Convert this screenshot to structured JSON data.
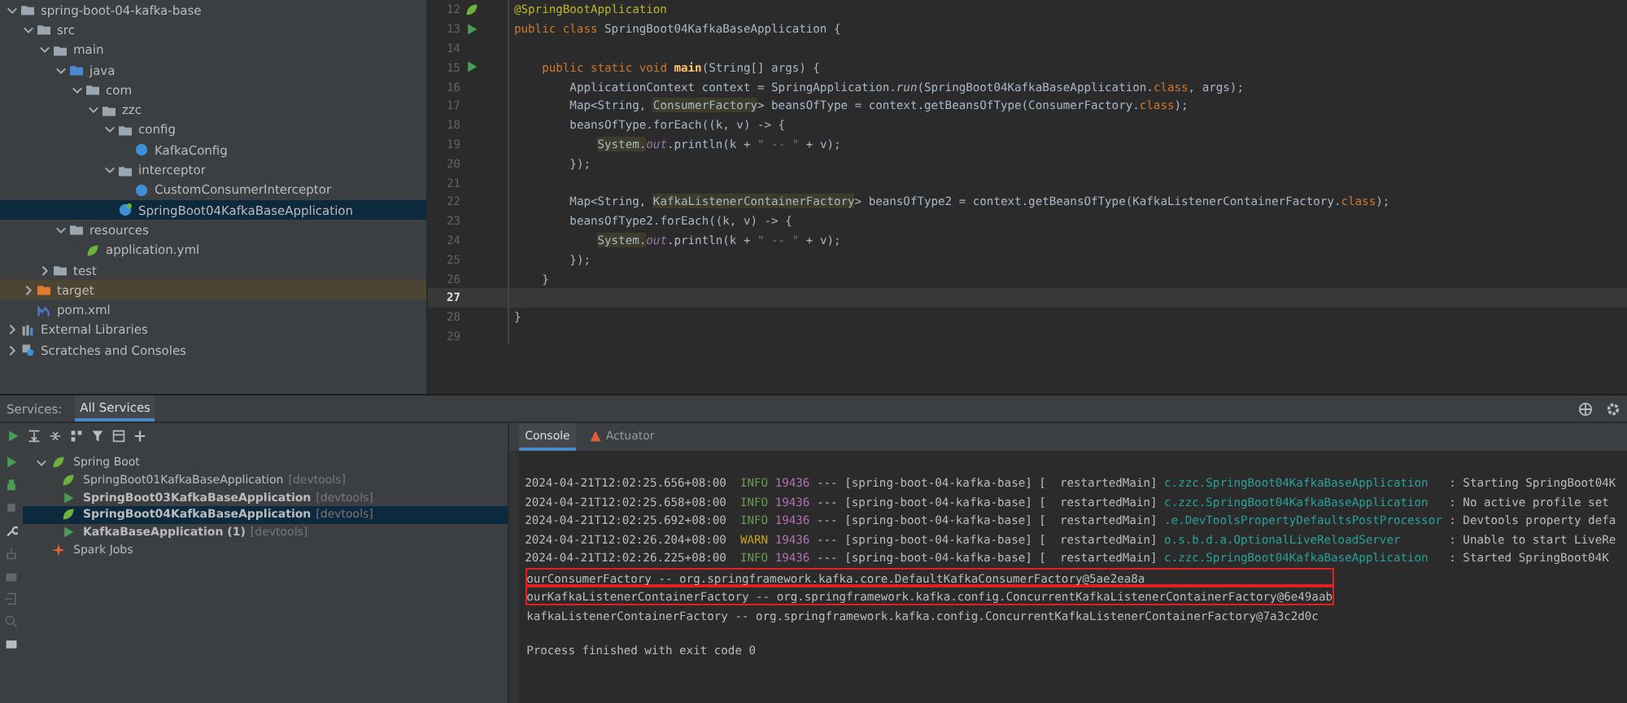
{
  "project_tree": [
    {
      "label": "spring-boot-04-kafka-base",
      "kind": "module",
      "expanded": true,
      "selected": false,
      "children": [
        {
          "label": "src",
          "kind": "folder",
          "expanded": true,
          "selected": false,
          "children": [
            {
              "label": "main",
              "kind": "folder",
              "expanded": true,
              "selected": false,
              "children": [
                {
                  "label": "java",
                  "kind": "source-folder",
                  "expanded": true,
                  "selected": false,
                  "children": [
                    {
                      "label": "com",
                      "kind": "package",
                      "expanded": true,
                      "selected": false,
                      "children": [
                        {
                          "label": "zzc",
                          "kind": "package",
                          "expanded": true,
                          "selected": false,
                          "children": [
                            {
                              "label": "config",
                              "kind": "package",
                              "expanded": true,
                              "selected": false,
                              "children": [
                                {
                                  "label": "KafkaConfig",
                                  "kind": "class",
                                  "selected": false
                                }
                              ]
                            },
                            {
                              "label": "interceptor",
                              "kind": "package",
                              "expanded": true,
                              "selected": false,
                              "children": [
                                {
                                  "label": "CustomConsumerInterceptor",
                                  "kind": "class",
                                  "selected": false
                                }
                              ]
                            },
                            {
                              "label": "SpringBoot04KafkaBaseApplication",
                              "kind": "spring-class",
                              "selected": true
                            }
                          ]
                        }
                      ]
                    }
                  ]
                },
                {
                  "label": "resources",
                  "kind": "resource-folder",
                  "expanded": true,
                  "selected": false,
                  "children": [
                    {
                      "label": "application.yml",
                      "kind": "yaml",
                      "selected": false
                    }
                  ]
                }
              ]
            },
            {
              "label": "test",
              "kind": "folder",
              "expanded": false,
              "selected": false
            }
          ]
        },
        {
          "label": "target",
          "kind": "excluded-folder",
          "expanded": false,
          "selected": false
        },
        {
          "label": "pom.xml",
          "kind": "maven",
          "selected": false
        }
      ]
    },
    {
      "label": "External Libraries",
      "kind": "library",
      "expanded": false,
      "selected": false
    },
    {
      "label": "Scratches and Consoles",
      "kind": "scratches",
      "expanded": false,
      "selected": false
    }
  ],
  "editor": {
    "lines": [
      {
        "number": "12",
        "kind": "spring",
        "current": false,
        "segments": [
          {
            "text": "@SpringBootApplication",
            "kind": "annotation"
          }
        ]
      },
      {
        "number": "13",
        "kind": "run",
        "current": false,
        "segments": [
          {
            "text": "public class ",
            "kind": "keyword"
          },
          {
            "text": "SpringBoot04KafkaBaseApplication {",
            "kind": "plain"
          }
        ]
      },
      {
        "number": "14",
        "kind": "plain",
        "current": false
      },
      {
        "number": "15",
        "kind": "run",
        "current": false,
        "segments": [
          {
            "text": "    public static void ",
            "kind": "keyword"
          },
          {
            "text": "main",
            "kind": "method"
          },
          {
            "text": "(String[] args) {",
            "kind": "plain"
          }
        ]
      },
      {
        "number": "16",
        "kind": "plain",
        "current": false,
        "segments": [
          {
            "text": "        ApplicationContext context = SpringApplication.",
            "kind": "plain"
          },
          {
            "text": "run",
            "kind": "static"
          },
          {
            "text": "(SpringBoot04KafkaBaseApplication.",
            "kind": "plain"
          },
          {
            "text": "class",
            "kind": "keyword"
          },
          {
            "text": ", args);",
            "kind": "plain"
          }
        ]
      },
      {
        "number": "17",
        "kind": "plain",
        "current": false,
        "segments": [
          {
            "text": "        Map<String, ",
            "kind": "plain"
          },
          {
            "text": "ConsumerFactory",
            "kind": "highlight"
          },
          {
            "text": "> beansOfType = context.getBeansOfType(ConsumerFactory.",
            "kind": "plain"
          },
          {
            "text": "class",
            "kind": "keyword"
          },
          {
            "text": ");",
            "kind": "plain"
          }
        ]
      },
      {
        "number": "18",
        "kind": "plain",
        "current": false,
        "segments": [
          {
            "text": "        beansOfType.forEach((k, v) -> {",
            "kind": "plain"
          }
        ]
      },
      {
        "number": "19",
        "kind": "plain",
        "current": false,
        "segments": [
          {
            "text": "            System.",
            "kind": "highlight"
          },
          {
            "text": "out",
            "kind": "field"
          },
          {
            "text": ".println(k + ",
            "kind": "plain"
          },
          {
            "text": "\" -- \"",
            "kind": "string"
          },
          {
            "text": " + v);",
            "kind": "plain"
          }
        ]
      },
      {
        "number": "20",
        "kind": "plain",
        "current": false,
        "segments": [
          {
            "text": "        });",
            "kind": "plain"
          }
        ]
      },
      {
        "number": "21",
        "kind": "plain",
        "current": false
      },
      {
        "number": "22",
        "kind": "plain",
        "current": false,
        "segments": [
          {
            "text": "        Map<String, ",
            "kind": "plain"
          },
          {
            "text": "KafkaListenerContainerFactory",
            "kind": "highlight"
          },
          {
            "text": "> beansOfType2 = context.getBeansOfType(KafkaListenerContainerFactory.",
            "kind": "plain"
          },
          {
            "text": "class",
            "kind": "keyword"
          },
          {
            "text": ");",
            "kind": "plain"
          }
        ]
      },
      {
        "number": "23",
        "kind": "plain",
        "current": false,
        "segments": [
          {
            "text": "        beansOfType2.forEach((k, v) -> {",
            "kind": "plain"
          }
        ]
      },
      {
        "number": "24",
        "kind": "plain",
        "current": false,
        "segments": [
          {
            "text": "            System.",
            "kind": "highlight"
          },
          {
            "text": "out",
            "kind": "field"
          },
          {
            "text": ".println(k + ",
            "kind": "plain"
          },
          {
            "text": "\" -- \"",
            "kind": "string"
          },
          {
            "text": " + v);",
            "kind": "plain"
          }
        ]
      },
      {
        "number": "25",
        "kind": "plain",
        "current": false,
        "segments": [
          {
            "text": "        });",
            "kind": "plain"
          }
        ]
      },
      {
        "number": "26",
        "kind": "plain",
        "current": false,
        "segments": [
          {
            "text": "    }",
            "kind": "plain"
          }
        ]
      },
      {
        "number": "27",
        "kind": "plain",
        "current": true
      },
      {
        "number": "28",
        "kind": "plain",
        "current": false,
        "segments": [
          {
            "text": "}",
            "kind": "plain"
          }
        ]
      },
      {
        "number": "29",
        "kind": "plain",
        "current": false
      }
    ]
  },
  "services": {
    "title": "Services:",
    "tabs": [
      {
        "label": "All Services",
        "selected": true
      }
    ],
    "tree": [
      {
        "label": "Spring Boot",
        "kind": "group",
        "expanded": true,
        "selected": false,
        "children": [
          {
            "label": "SpringBoot01KafkaBaseApplication",
            "tag": "[devtools]",
            "kind": "idle",
            "selected": false
          },
          {
            "label": "SpringBoot03KafkaBaseApplication",
            "tag": "[devtools]",
            "kind": "running",
            "selected": false
          },
          {
            "label": "SpringBoot04KafkaBaseApplication",
            "tag": "[devtools]",
            "kind": "finished",
            "selected": true
          },
          {
            "label": "KafkaBaseApplication (1)",
            "tag": "[devtools]",
            "kind": "running",
            "selected": false
          }
        ]
      },
      {
        "label": "Spark Jobs",
        "kind": "spark",
        "selected": false
      }
    ]
  },
  "console": {
    "tabs": [
      {
        "label": "Console",
        "selected": true
      },
      {
        "label": "Actuator",
        "selected": false
      }
    ],
    "log": [
      {
        "time": "2024-04-21T12:02:25.656+08:00",
        "level": "INFO",
        "pid": "19436",
        "thread": "--- [spring-boot-04-kafka-base] [  restartedMain]",
        "logger": "c.zzc.SpringBoot04KafkaBaseApplication   ",
        "message": ": Starting SpringBoot04K"
      },
      {
        "time": "2024-04-21T12:02:25.658+08:00",
        "level": "INFO",
        "pid": "19436",
        "thread": "--- [spring-boot-04-kafka-base] [  restartedMain]",
        "logger": "c.zzc.SpringBoot04KafkaBaseApplication   ",
        "message": ": No active profile set"
      },
      {
        "time": "2024-04-21T12:02:25.692+08:00",
        "level": "INFO",
        "pid": "19436",
        "thread": "--- [spring-boot-04-kafka-base] [  restartedMain]",
        "logger": ".e.DevToolsPropertyDefaultsPostProcessor ",
        "message": ": Devtools property defa"
      },
      {
        "time": "2024-04-21T12:02:26.204+08:00",
        "level": "WARN",
        "pid": "19436",
        "thread": "--- [spring-boot-04-kafka-base] [  restartedMain]",
        "logger": "o.s.b.d.a.OptionalLiveReloadServer       ",
        "message": ": Unable to start LiveRe"
      },
      {
        "time": "2024-04-21T12:02:26.225+08:00",
        "level": "INFO",
        "pid": "19436",
        "thread": "--- [spring-boot-04-kafka-base] [  restartedMain]",
        "logger": "c.zzc.SpringBoot04KafkaBaseApplication   ",
        "message": ": Started SpringBoot04K"
      }
    ],
    "output": [
      {
        "text": "ourConsumerFactory -- org.springframework.kafka.core.DefaultKafkaConsumerFactory@5ae2ea8a",
        "highlighted": true
      },
      {
        "text": "ourKafkaListenerContainerFactory -- org.springframework.kafka.config.ConcurrentKafkaListenerContainerFactory@6e49aab",
        "highlighted": true
      },
      {
        "text": "kafkaListenerContainerFactory -- org.springframework.kafka.config.ConcurrentKafkaListenerContainerFactory@7a3c2d0c",
        "highlighted": false
      }
    ],
    "exit_message": "Process finished with exit code 0"
  }
}
